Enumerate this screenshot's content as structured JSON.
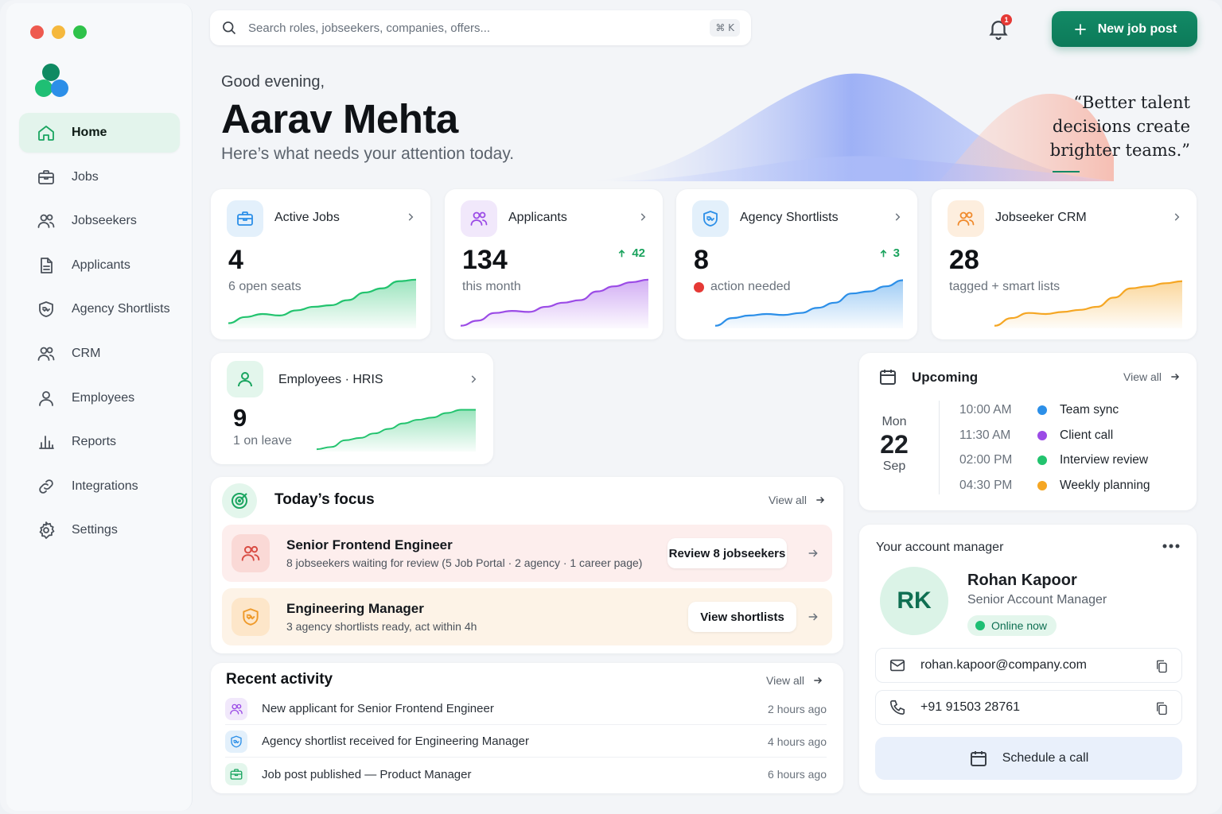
{
  "window": {
    "traffic_lights": [
      "#ee5a4f",
      "#f5b83d",
      "#2fc24a"
    ]
  },
  "brand": {
    "logo_colors": [
      "#0f8a62",
      "#2c8fe8",
      "#1fbf74"
    ]
  },
  "sidebar": {
    "items": [
      {
        "label": "Home",
        "icon": "home-icon",
        "active": true
      },
      {
        "label": "Jobs",
        "icon": "briefcase-icon"
      },
      {
        "label": "Jobseekers",
        "icon": "users-icon"
      },
      {
        "label": "Applicants",
        "icon": "document-icon"
      },
      {
        "label": "Agency Shortlists",
        "icon": "shield-handshake-icon"
      },
      {
        "label": "CRM",
        "icon": "users-icon"
      },
      {
        "label": "Employees",
        "icon": "user-icon"
      },
      {
        "label": "Reports",
        "icon": "bar-chart-icon"
      },
      {
        "label": "Integrations",
        "icon": "link-icon"
      },
      {
        "label": "Settings",
        "icon": "gear-icon"
      }
    ]
  },
  "topbar": {
    "search_placeholder": "Search roles, jobseekers, companies, offers...",
    "shortcut": "⌘ K",
    "notifications_count": "1",
    "new_job_label": "New job post"
  },
  "hero": {
    "greeting": "Good evening,",
    "name": "Aarav Mehta",
    "subtitle": "Here’s what needs your attention today.",
    "quote": "“Better talent decisions create brighter teams.”"
  },
  "stats": [
    {
      "title": "Active Jobs",
      "value": "4",
      "sub": "6 open seats",
      "color": "#22c36e",
      "icon_bg": "#e3f0fb",
      "icon_color": "#2c8fe8",
      "icon": "briefcase-icon",
      "trend": [
        0.1,
        0.22,
        0.28,
        0.25,
        0.35,
        0.42,
        0.45,
        0.55,
        0.7,
        0.78,
        0.92,
        0.95
      ]
    },
    {
      "title": "Applicants",
      "value": "134",
      "sub": "this month",
      "delta": "42",
      "color": "#9b4be6",
      "icon_bg": "#f1e8fb",
      "icon_color": "#9b4be6",
      "icon": "users-icon",
      "trend": [
        0.05,
        0.15,
        0.3,
        0.34,
        0.32,
        0.42,
        0.5,
        0.55,
        0.72,
        0.82,
        0.9,
        0.95
      ]
    },
    {
      "title": "Agency Shortlists",
      "value": "8",
      "sub": "action needed",
      "delta": "3",
      "color": "#2c8fe8",
      "icon_bg": "#e3f0fb",
      "icon_color": "#2c8fe8",
      "icon": "shield-handshake-icon",
      "alert_color": "#e53935",
      "trend": [
        0.05,
        0.2,
        0.25,
        0.28,
        0.26,
        0.3,
        0.4,
        0.5,
        0.68,
        0.72,
        0.82,
        0.94
      ]
    },
    {
      "title": "Jobseeker CRM",
      "value": "28",
      "sub": "tagged + smart lists",
      "color": "#f5a623",
      "icon_bg": "#fdeede",
      "icon_color": "#f08a2c",
      "icon": "users-icon",
      "trend": [
        0.05,
        0.2,
        0.3,
        0.28,
        0.32,
        0.36,
        0.42,
        0.6,
        0.78,
        0.82,
        0.88,
        0.92
      ]
    }
  ],
  "employees": {
    "title": "Employees · HRIS",
    "value": "9",
    "sub": "1 on leave",
    "color": "#22c36e",
    "icon_bg": "#e3f6ec",
    "icon_color": "#1aa560",
    "trend": [
      0.05,
      0.1,
      0.25,
      0.3,
      0.4,
      0.5,
      0.62,
      0.7,
      0.75,
      0.85,
      0.92,
      0.92
    ]
  },
  "focus": {
    "title": "Today’s focus",
    "view_all": "View all",
    "items": [
      {
        "title": "Senior Frontend Engineer",
        "sub": "8 jobseekers waiting for review (5 Job Portal · 2 agency · 1 career page)",
        "button": "Review 8 jobseekers",
        "bg": "#fdeeed",
        "icon_bg": "#fad9d6",
        "icon_color": "#d94c43"
      },
      {
        "title": "Engineering Manager",
        "sub": "3 agency shortlists ready, act within 4h",
        "button": "View shortlists",
        "bg": "#fdf3e7",
        "icon_bg": "#fde6c9",
        "icon_color": "#ef9a2a"
      }
    ]
  },
  "activity": {
    "title": "Recent activity",
    "view_all": "View all",
    "items": [
      {
        "text": "New applicant for Senior Frontend Engineer",
        "time": "2 hours ago",
        "icon_bg": "#f1e8fb",
        "icon_color": "#9b4be6"
      },
      {
        "text": "Agency shortlist received for Engineering Manager",
        "time": "4 hours ago",
        "icon_bg": "#e3f0fb",
        "icon_color": "#2c8fe8"
      },
      {
        "text": "Job post published — Product Manager",
        "time": "6 hours ago",
        "icon_bg": "#e3f6ec",
        "icon_color": "#1aa560"
      }
    ]
  },
  "upcoming": {
    "title": "Upcoming",
    "view_all": "View all",
    "day": "Mon",
    "date": "22",
    "month": "Sep",
    "events": [
      {
        "time": "10:00 AM",
        "name": "Team sync",
        "color": "#2c8fe8"
      },
      {
        "time": "11:30 AM",
        "name": "Client call",
        "color": "#9b4be6"
      },
      {
        "time": "02:00 PM",
        "name": "Interview review",
        "color": "#22c36e"
      },
      {
        "time": "04:30 PM",
        "name": "Weekly planning",
        "color": "#f5a623"
      }
    ]
  },
  "manager": {
    "heading": "Your account manager",
    "initials": "RK",
    "name": "Rohan Kapoor",
    "role": "Senior Account Manager",
    "status": "Online now",
    "email": "rohan.kapoor@company.com",
    "phone": "+91 91503 28761",
    "schedule_label": "Schedule a call"
  }
}
